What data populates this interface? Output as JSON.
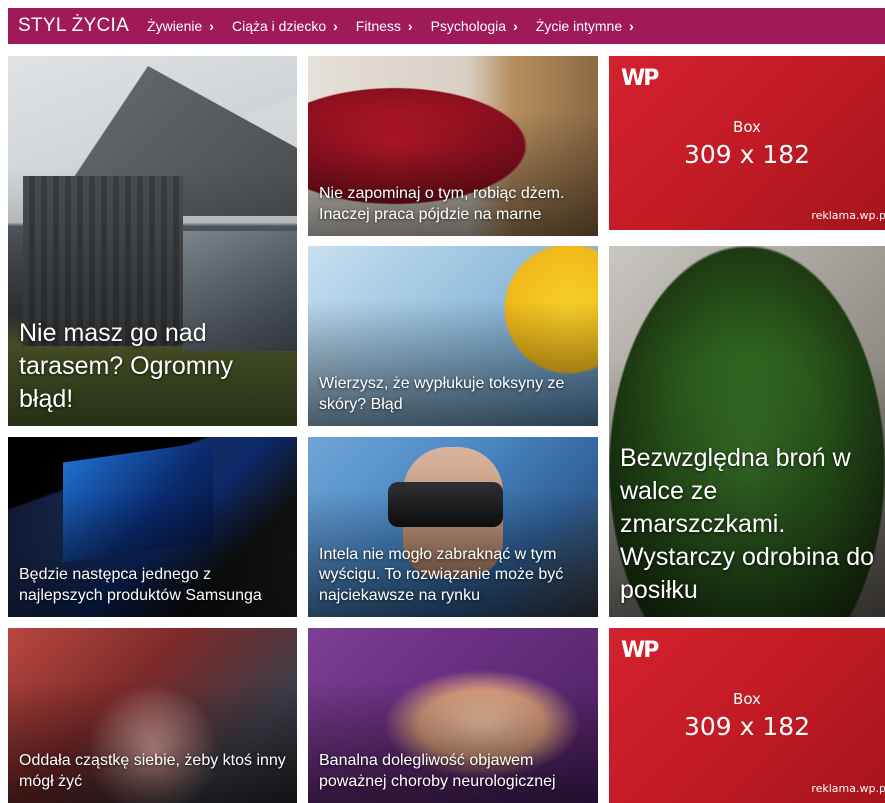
{
  "header": {
    "brand": "STYL ŻYCIA",
    "nav": [
      {
        "label": "Żywienie",
        "chevron": "›"
      },
      {
        "label": "Ciąża i dziecko",
        "chevron": "›"
      },
      {
        "label": "Fitness",
        "chevron": "›"
      },
      {
        "label": "Psychologia",
        "chevron": "›"
      },
      {
        "label": "Życie intymne",
        "chevron": "›"
      }
    ],
    "background_color": "#a01a5a"
  },
  "articles": [
    {
      "title": "Nie masz go nad tarasem? Ogromny błąd!"
    },
    {
      "title": "Nie zapominaj o tym, robiąc dżem. Inaczej praca pójdzie na marne"
    },
    {
      "title": "Wierzysz, że wypłukuje toksyny ze skóry? Błąd"
    },
    {
      "title": "Bezwzględna broń w walce ze zmarszczkami. Wystarczy odrobina do posiłku"
    },
    {
      "title": "Będzie następca jednego z najlepszych produktów Samsunga"
    },
    {
      "title": "Intela nie mogło zabraknąć w tym wyścigu. To rozwiązanie może być najciekawsze na rynku"
    },
    {
      "title": "Oddała cząstkę siebie, żeby ktoś inny mógł żyć"
    },
    {
      "title": "Banalna dolegliwość objawem poważnej choroby neurologicznej"
    }
  ],
  "ads": [
    {
      "logo": "WP",
      "label": "Box",
      "size": "309 x 182",
      "footer": "reklama.wp.pl"
    },
    {
      "logo": "WP",
      "label": "Box",
      "size": "309 x 182",
      "footer": "reklama.wp.pl"
    }
  ],
  "ad_color": "#c21b25"
}
